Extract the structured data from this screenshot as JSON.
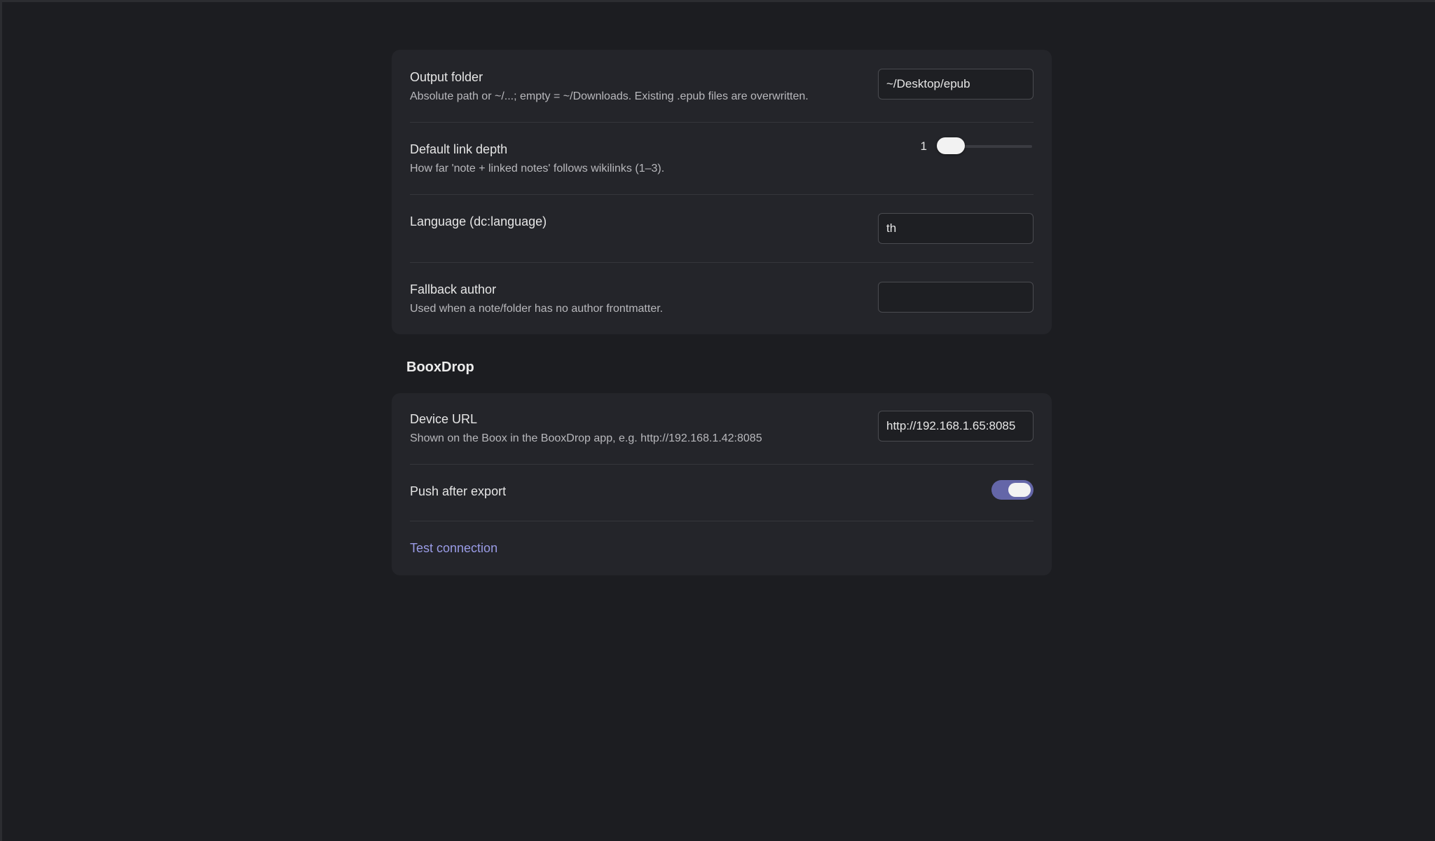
{
  "general": {
    "output_folder": {
      "title": "Output folder",
      "description": "Absolute path or ~/...; empty = ~/Downloads. Existing .epub files are overwritten.",
      "value": "~/Desktop/epub"
    },
    "link_depth": {
      "title": "Default link depth",
      "description": "How far 'note + linked notes' follows wikilinks (1–3).",
      "value": "1",
      "min": 1,
      "max": 3,
      "level_fraction": 0
    },
    "language": {
      "title": "Language (dc:language)",
      "value": "th"
    },
    "fallback_author": {
      "title": "Fallback author",
      "description": "Used when a note/folder has no author frontmatter.",
      "value": ""
    }
  },
  "booxdrop": {
    "heading": "BooxDrop",
    "device_url": {
      "title": "Device URL",
      "description": "Shown on the Boox in the BooxDrop app, e.g. http://192.168.1.42:8085",
      "value": "http://192.168.1.65:8085"
    },
    "push_after_export": {
      "title": "Push after export",
      "enabled": true
    },
    "test_connection_label": "Test connection"
  },
  "colors": {
    "background": "#1c1d21",
    "card": "#24252a",
    "accent": "#6466a8",
    "link": "#9a9ce6"
  }
}
